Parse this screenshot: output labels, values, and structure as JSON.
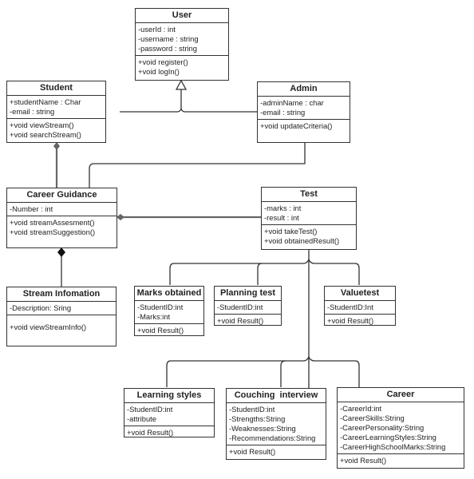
{
  "diagram_type": "UML class diagram",
  "classes": {
    "user": {
      "name": "User",
      "attributes": [
        "-userId : int",
        "-username : string",
        "-password : string"
      ],
      "operations": [
        "+void register()",
        "+void logIn()"
      ]
    },
    "student": {
      "name": "Student",
      "attributes": [
        "+studentName : Char",
        "-email : string"
      ],
      "operations": [
        "+void viewStream()",
        "+void searchStream()"
      ]
    },
    "admin": {
      "name": "Admin",
      "attributes": [
        "-adminName : char",
        "-email : string"
      ],
      "operations": [
        "+void updateCriteria()"
      ]
    },
    "career_guidance": {
      "name": "Career Guidance",
      "attributes": [
        "-Number : int"
      ],
      "operations": [
        "+void streamAssesment()",
        "+void streamSuggestion()"
      ]
    },
    "test": {
      "name": "Test",
      "attributes": [
        "-marks : int",
        "-result : int"
      ],
      "operations": [
        "+void takeTest()",
        "+void obtainedResult()"
      ]
    },
    "stream_information": {
      "name": "Stream Infomation",
      "attributes": [
        "-Description: Sring"
      ],
      "operations": [
        "+void viewStreamInfo()"
      ]
    },
    "marks_obtained": {
      "name": "Marks obtained",
      "attributes": [
        "-StudentID:int",
        "-Marks:int"
      ],
      "operations": [
        "+void Result()"
      ]
    },
    "planning_test": {
      "name": "Planning test",
      "attributes": [
        "-StudentID:int"
      ],
      "operations": [
        "+void Result()"
      ]
    },
    "valuetest": {
      "name": "Valuetest",
      "attributes": [
        "-StudentID:Int"
      ],
      "operations": [
        "+void Result()"
      ]
    },
    "learning_styles": {
      "name": "Learning styles",
      "attributes": [
        "-StudentID:int",
        "-attribute"
      ],
      "operations": [
        "+void Result()"
      ]
    },
    "couching_interview": {
      "name": "Couching  interview",
      "attributes": [
        "-StudentID:int",
        "-Strengths:String",
        "-Weaknesses:String",
        "-Recommendations:String"
      ],
      "operations": [
        "+void Result()"
      ]
    },
    "career": {
      "name": "Career",
      "attributes": [
        "-CareerId:int",
        "-CareerSkills:String",
        "-CareerPersonality:String",
        "-CareerLearningStyles:String",
        "-CareerHighSchoolMarks:String"
      ],
      "operations": [
        "+void Result()"
      ]
    }
  },
  "relationships": [
    {
      "from": "Student",
      "to": "User",
      "type": "generalization"
    },
    {
      "from": "Admin",
      "to": "User",
      "type": "generalization"
    },
    {
      "from": "Career Guidance",
      "to": "Student",
      "type": "composition"
    },
    {
      "from": "Admin",
      "to": "Career Guidance",
      "type": "association"
    },
    {
      "from": "Test",
      "to": "Career Guidance",
      "type": "composition"
    },
    {
      "from": "Stream Infomation",
      "to": "Career Guidance",
      "type": "composition"
    },
    {
      "from": "Marks obtained",
      "to": "Test",
      "type": "association"
    },
    {
      "from": "Planning test",
      "to": "Test",
      "type": "association"
    },
    {
      "from": "Valuetest",
      "to": "Test",
      "type": "association"
    },
    {
      "from": "Learning styles",
      "to": "Test",
      "type": "association"
    },
    {
      "from": "Couching  interview",
      "to": "Test",
      "type": "association"
    },
    {
      "from": "Career",
      "to": "Test",
      "type": "association"
    }
  ]
}
